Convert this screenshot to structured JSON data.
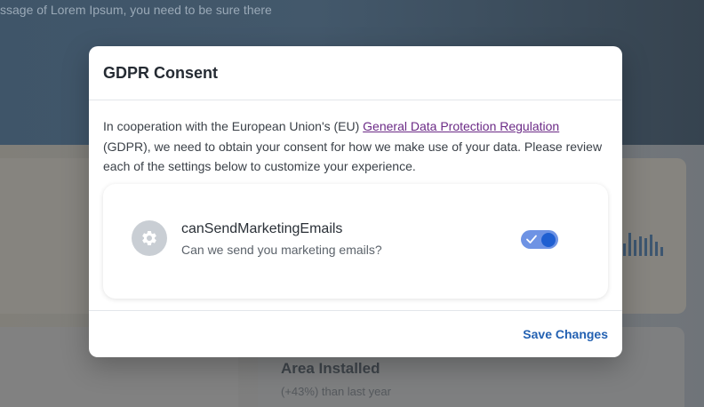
{
  "background": {
    "header_text": "ssage of Lorem Ipsum, you need to be sure there",
    "stat_title": "Area Installed",
    "stat_subtitle": "(+43%) than last year"
  },
  "modal": {
    "title": "GDPR Consent",
    "intro_before_link": "In cooperation with the European Union's (EU) ",
    "intro_link": "General Data Protection Regulation",
    "intro_after_link": " (GDPR), we need to obtain your consent for how we make use of your data. Please review each of the settings below to customize your experience.",
    "setting": {
      "icon": "gear-icon",
      "name": "canSendMarketingEmails",
      "description": "Can we send you marketing emails?",
      "enabled": true
    },
    "save_label": "Save Changes"
  },
  "colors": {
    "link": "#6b2a86",
    "toggle_track": "#6e93e4",
    "toggle_knob": "#1f5fd1",
    "save_button": "#2361b2"
  }
}
